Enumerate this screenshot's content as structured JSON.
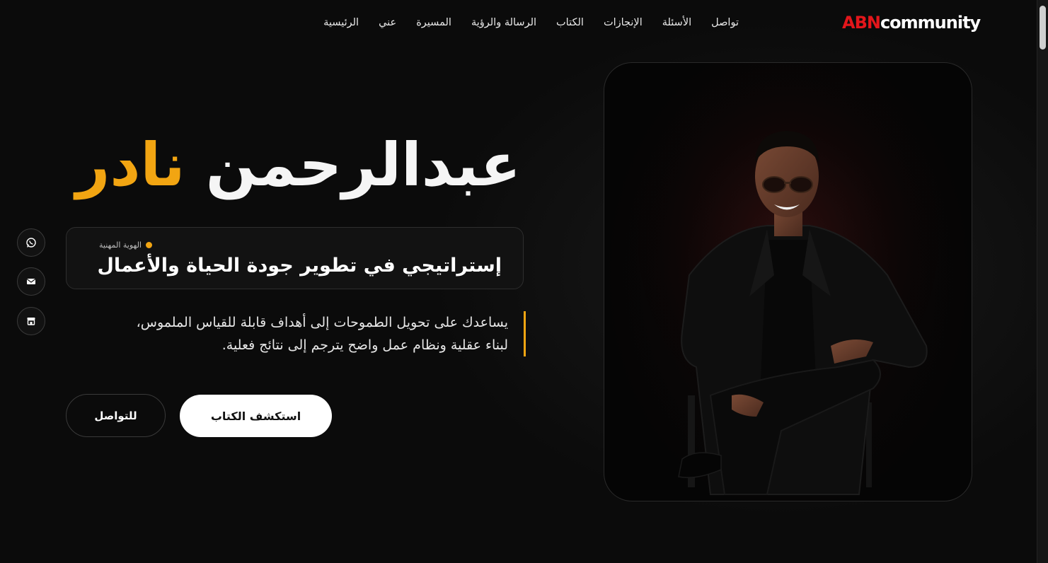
{
  "brand": {
    "logo_red": "ABN",
    "logo_white": "community"
  },
  "nav": {
    "items": [
      "الرئيسية",
      "عني",
      "المسيرة",
      "الرسالة والرؤية",
      "الكتاب",
      "الإنجازات",
      "الأسئلة",
      "تواصل"
    ]
  },
  "hero": {
    "first_name": "عبدالرحمن",
    "last_name": "نادر",
    "identity_tag": "الهوية المهنية",
    "identity_title": "إستراتيجي في تطوير جودة الحياة والأعمال",
    "description_line1": "يساعدك على تحويل الطموحات إلى أهداف قابلة للقياس الملموس،",
    "description_line2": "لبناء عقلية ونظام عمل واضح يترجم إلى نتائج فعلية.",
    "primary_button": "استكشف الكتاب",
    "secondary_button": "للتواصل"
  },
  "social": {
    "icons": [
      "whatsapp-icon",
      "mail-icon",
      "store-icon"
    ]
  },
  "colors": {
    "accent": "#f2a512",
    "brand_red": "#e3161b",
    "background": "#0b0b0b"
  }
}
